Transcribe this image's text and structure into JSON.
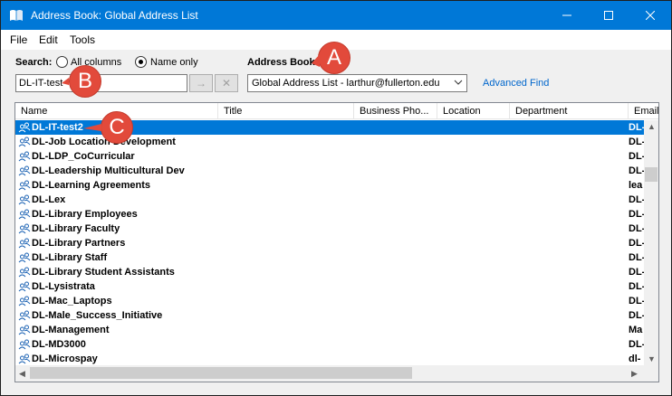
{
  "window": {
    "title": "Address Book: Global Address List"
  },
  "menu": [
    "File",
    "Edit",
    "Tools"
  ],
  "search": {
    "label": "Search:",
    "option_all": "All columns",
    "option_name": "Name only",
    "selected": "Name only",
    "value": "DL-IT-test",
    "go_glyph": "→",
    "clear_glyph": "✕"
  },
  "address_book": {
    "label": "Address Book:",
    "value": "Global Address List - larthur@fullerton.edu",
    "advanced_find": "Advanced Find"
  },
  "columns": [
    "Name",
    "Title",
    "Business Pho...",
    "Location",
    "Department",
    "Email"
  ],
  "rows": [
    {
      "name": "DL-IT-test2",
      "email": "DL-",
      "selected": true
    },
    {
      "name": "DL-Job Location Development",
      "email": "DL-"
    },
    {
      "name": "DL-LDP_CoCurricular",
      "email": "DL-"
    },
    {
      "name": "DL-Leadership Multicultural Dev",
      "email": "DL-"
    },
    {
      "name": "DL-Learning Agreements",
      "email": "lea"
    },
    {
      "name": "DL-Lex",
      "email": "DL-"
    },
    {
      "name": "DL-Library Employees",
      "email": "DL-"
    },
    {
      "name": "DL-Library Faculty",
      "email": "DL-"
    },
    {
      "name": "DL-Library Partners",
      "email": "DL-"
    },
    {
      "name": "DL-Library Staff",
      "email": "DL-"
    },
    {
      "name": "DL-Library Student Assistants",
      "email": "DL-"
    },
    {
      "name": "DL-Lysistrata",
      "email": "DL-"
    },
    {
      "name": "DL-Mac_Laptops",
      "email": "DL-"
    },
    {
      "name": "DL-Male_Success_Initiative",
      "email": "DL-"
    },
    {
      "name": "DL-Management",
      "email": "Ma"
    },
    {
      "name": "DL-MD3000",
      "email": "DL-"
    },
    {
      "name": "DL-Microspay",
      "email": "dl-"
    }
  ],
  "callouts": {
    "a": "A",
    "b": "B",
    "c": "C"
  },
  "colors": {
    "titlebar": "#0078d7",
    "selection": "#0078d7",
    "callout": "#e24a3b",
    "link": "#0066cc"
  },
  "icons": [
    "address-book-icon",
    "minimize-icon",
    "maximize-icon",
    "close-icon",
    "distribution-list-icon",
    "chevron-down-icon",
    "arrow-right-icon"
  ]
}
